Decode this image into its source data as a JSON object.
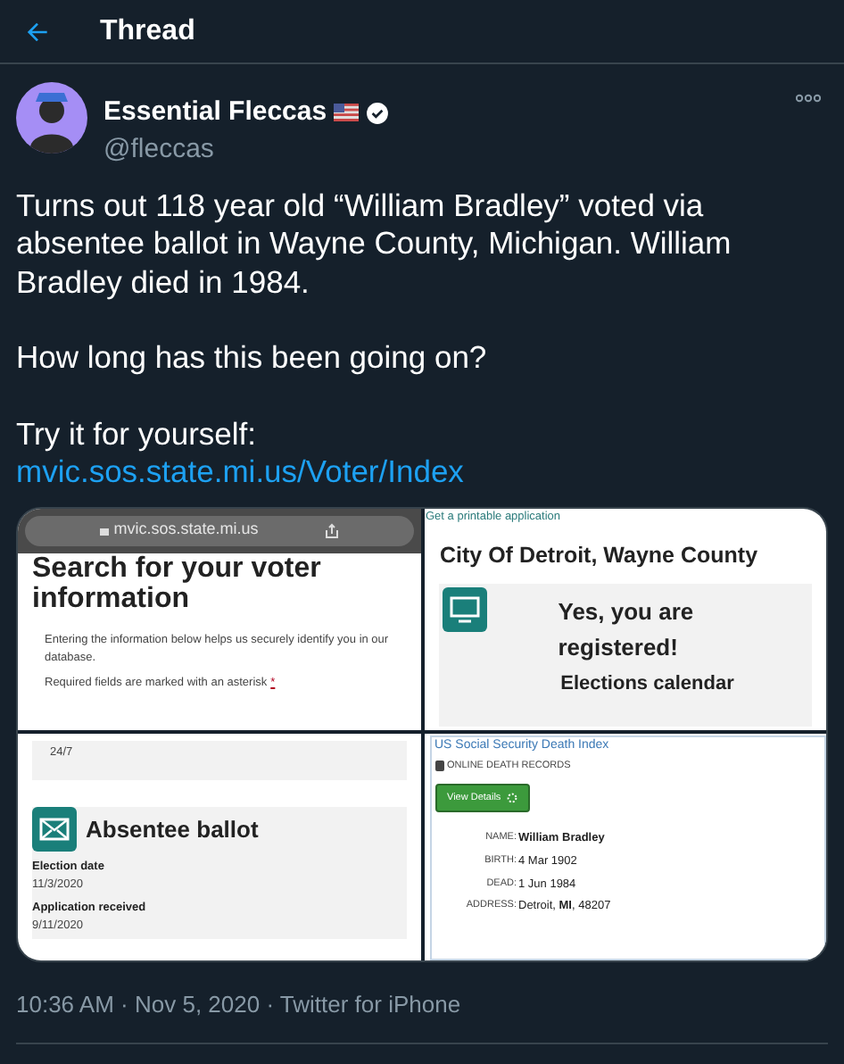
{
  "header": {
    "title": "Thread"
  },
  "tweet": {
    "name": "Essential Fleccas",
    "handle": "@fleccas",
    "paragraphs": [
      "Turns out 118 year old “William Bradley” voted via absentee ballot in Wayne County, Michigan. William Bradley died in 1984.",
      "How long has this been going on?",
      "Try it for yourself:"
    ],
    "link": "mvic.sos.state.mi.us/Voter/Index",
    "meta": "10:36 AM · Nov 5, 2020 · Twitter for iPhone"
  },
  "media": {
    "search_page": {
      "url": "mvic.sos.state.mi.us",
      "heading": "Search for your voter information",
      "intro": "Entering the information below helps us securely identify you in our database.",
      "required": "Required fields are marked with an asterisk",
      "asterisk": "*"
    },
    "ballot_page": {
      "hours": "24/7",
      "title": "Absentee ballot",
      "fields": [
        {
          "label": "Election date",
          "value": "11/3/2020"
        },
        {
          "label": "Application received",
          "value": "9/11/2020"
        }
      ]
    },
    "registration_page": {
      "link": "Get a printable application",
      "city": "City Of Detroit, Wayne County",
      "status": "Yes, you are registered!",
      "next": "Elections calendar"
    },
    "death_record": {
      "source": "US Social Security Death Index",
      "category": "ONLINE DEATH RECORDS",
      "button": "View Details",
      "rows": [
        {
          "label": "NAME:",
          "value": "William Bradley",
          "bold": true
        },
        {
          "label": "BIRTH:",
          "value": "4 Mar 1902",
          "bold": false
        },
        {
          "label": "DEAD:",
          "value": "1 Jun 1984",
          "bold": false
        },
        {
          "label": "ADDRESS:",
          "value": "Detroit, **MI**, 48207",
          "bold": false
        }
      ]
    }
  }
}
